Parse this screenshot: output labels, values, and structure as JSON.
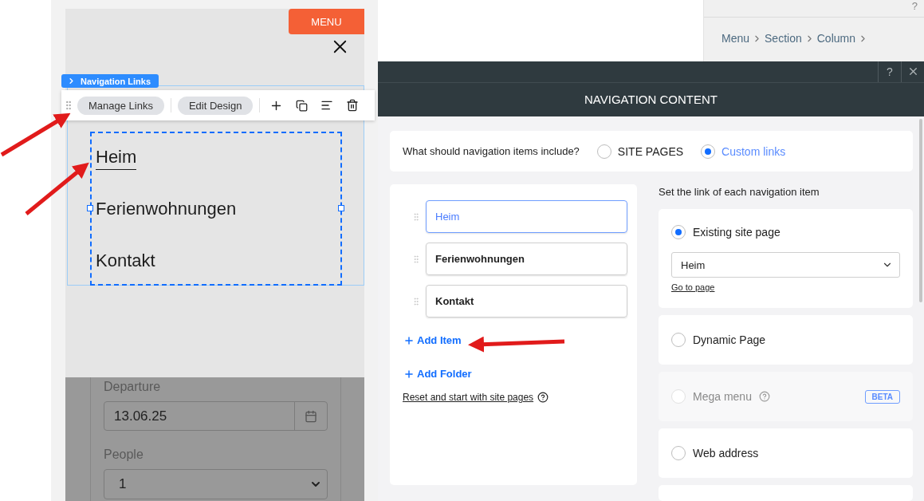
{
  "canvas": {
    "menu_button": "MENU",
    "element_tag": "Navigation Links",
    "toolbar": {
      "buttons": [
        "Manage Links",
        "Edit Design"
      ]
    },
    "nav_links": [
      {
        "label": "Heim",
        "selected": true
      },
      {
        "label": "Ferienwohnungen",
        "selected": false
      },
      {
        "label": "Kontakt",
        "selected": false
      }
    ],
    "form": {
      "fields": [
        {
          "kind": "date",
          "label": "Departure",
          "value": "13.06.25"
        },
        {
          "kind": "select",
          "label": "People",
          "value": "1"
        }
      ]
    }
  },
  "inspector": {
    "help": "?",
    "breadcrumb": [
      "Menu",
      "Section",
      "Column"
    ]
  },
  "dialog": {
    "help": "?",
    "title": "NAVIGATION CONTENT",
    "question": "What should navigation items include?",
    "options": [
      {
        "label": "SITE PAGES",
        "selected": false
      },
      {
        "label": "Custom links",
        "selected": true
      }
    ],
    "items": [
      {
        "label": "Heim",
        "selected": true
      },
      {
        "label": "Ferienwohnungen",
        "selected": false
      },
      {
        "label": "Kontakt",
        "selected": false
      }
    ],
    "add_item": "Add Item",
    "add_folder": "Add Folder",
    "reset": "Reset and start with site pages",
    "link_heading": "Set the link of each navigation item",
    "link_types": [
      {
        "label": "Existing site page",
        "selected": true,
        "disabled": false,
        "help": false,
        "dropdown": "Heim",
        "link": "Go to page"
      },
      {
        "label": "Dynamic Page",
        "selected": false,
        "disabled": false,
        "help": false
      },
      {
        "label": "Mega menu",
        "selected": false,
        "disabled": true,
        "help": true,
        "badge": "BETA"
      },
      {
        "label": "Web address",
        "selected": false,
        "disabled": false,
        "help": false
      }
    ]
  }
}
